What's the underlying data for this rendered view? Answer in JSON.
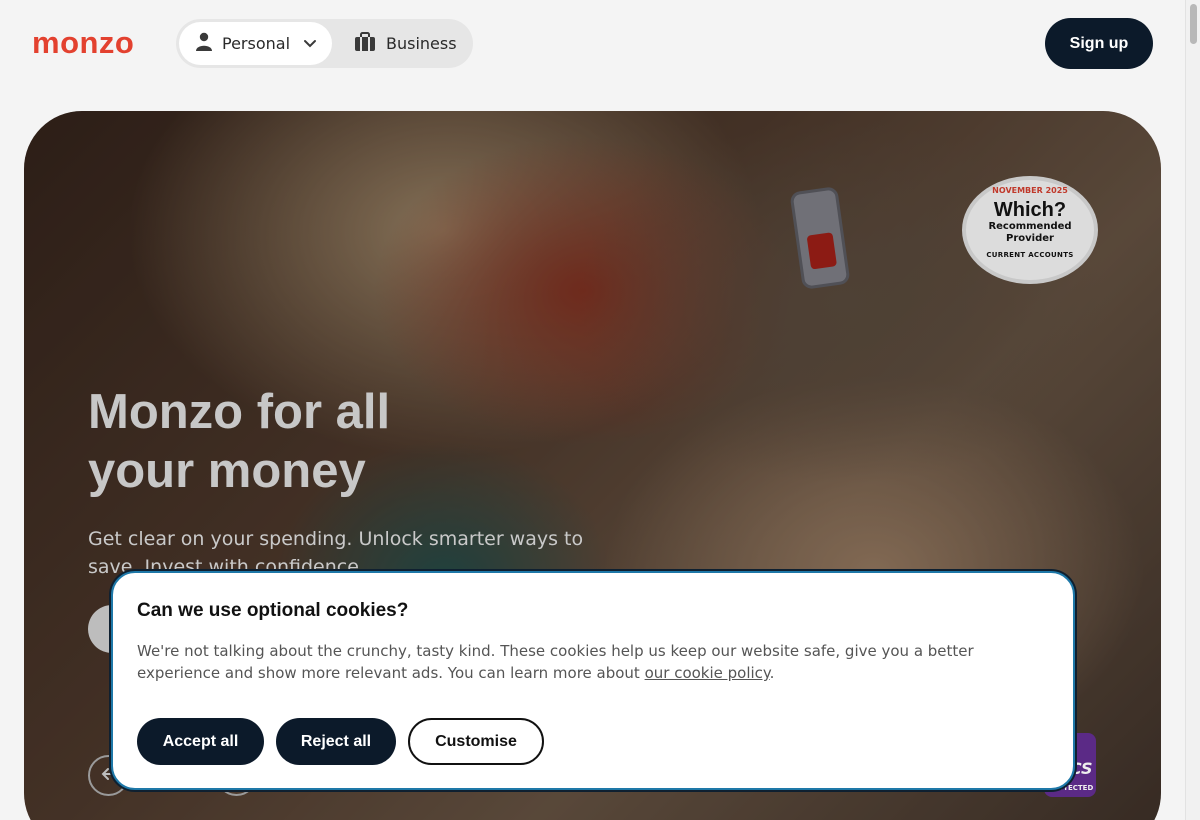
{
  "header": {
    "logo": "monzo",
    "personal_label": "Personal",
    "business_label": "Business",
    "signup_label": "Sign up"
  },
  "hero": {
    "title": "Monzo for all your money",
    "subtitle": "Get clear on your spending. Unlock smarter ways to save. Invest with confidence."
  },
  "badge": {
    "top": "NOVEMBER 2025",
    "brand": "Which?",
    "line1": "Recommended",
    "line2": "Provider",
    "bottom": "CURRENT ACCOUNTS"
  },
  "fscs": {
    "mark": "FSCS",
    "label": "PROTECTED"
  },
  "cookie": {
    "title": "Can we use optional cookies?",
    "text_before": "We're not talking about the crunchy, tasty kind. These cookies help us keep our website safe, give you a better experience and show more relevant ads. You can learn more about ",
    "link_text": "our cookie policy",
    "text_after": ".",
    "accept_label": "Accept all",
    "reject_label": "Reject all",
    "customise_label": "Customise"
  },
  "colors": {
    "brand": "#e3412f",
    "dark": "#0c1a2a",
    "modal_border": "#1e78a8"
  }
}
